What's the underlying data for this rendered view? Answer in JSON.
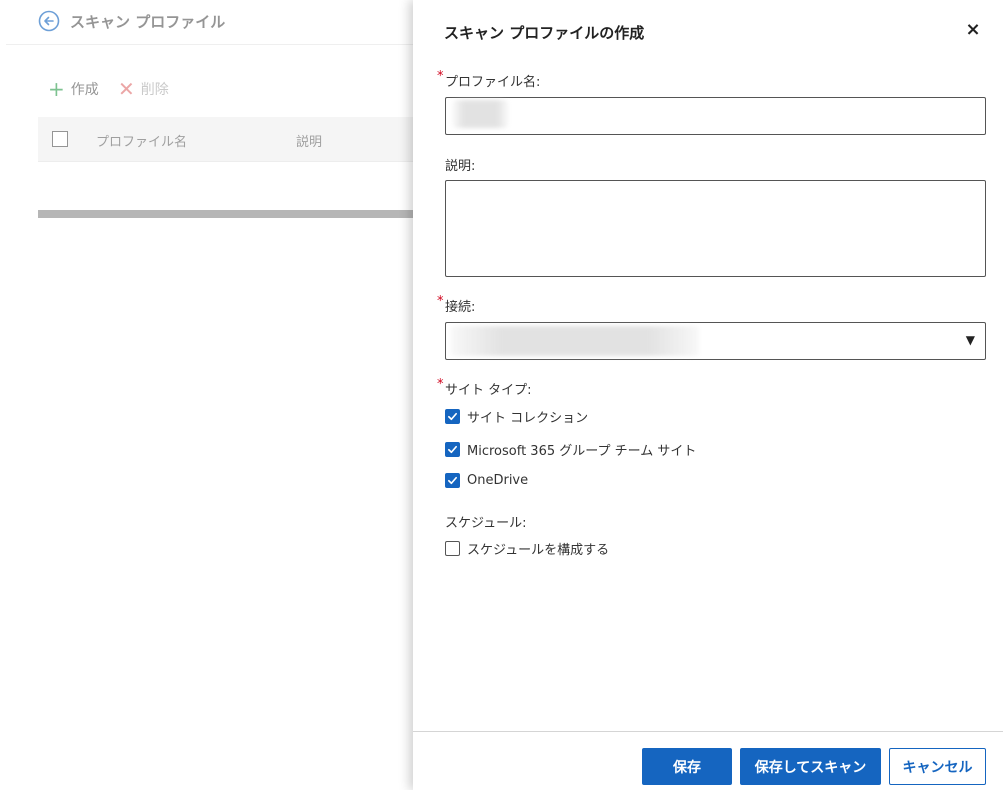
{
  "background": {
    "title": "スキャン プロファイル",
    "toolbar": {
      "create_label": "作成",
      "delete_label": "削除"
    },
    "table": {
      "columns": [
        "プロファイル名",
        "説明"
      ]
    }
  },
  "dialog": {
    "title": "スキャン プロファイルの作成",
    "close_glyph": "×",
    "required_mark": "*",
    "fields": {
      "profile_name": {
        "label": "プロファイル名:",
        "value": ""
      },
      "description": {
        "label": "説明:",
        "value": ""
      },
      "connection": {
        "label": "接続:",
        "selected": ""
      },
      "site_type": {
        "label": "サイト タイプ:",
        "options": [
          {
            "label": "サイト コレクション",
            "checked": true
          },
          {
            "label": "Microsoft 365 グループ チーム サイト",
            "checked": true
          },
          {
            "label": "OneDrive",
            "checked": true
          }
        ]
      },
      "schedule": {
        "label": "スケジュール:",
        "option": {
          "label": "スケジュールを構成する",
          "checked": false
        }
      }
    },
    "buttons": {
      "save": "保存",
      "save_and_scan": "保存してスキャン",
      "cancel": "キャンセル"
    }
  },
  "colors": {
    "accent": "#1565c0",
    "required": "#d0021b"
  }
}
